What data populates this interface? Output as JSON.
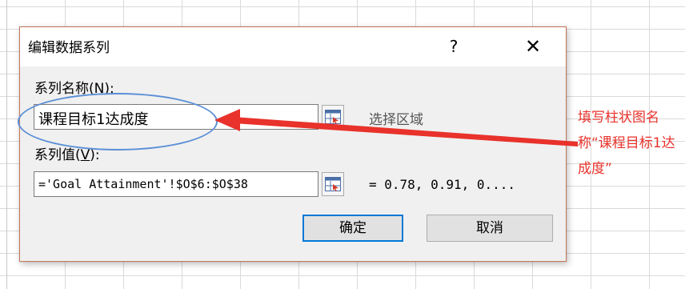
{
  "dialog": {
    "title": "编辑数据系列",
    "help_label": "?",
    "close_label": "✕",
    "series_name_label_prefix": "系列名称(",
    "series_name_label_key": "N",
    "series_name_label_suffix": "):",
    "series_name_value": "课程目标1达成度",
    "series_name_hint": "选择区域",
    "series_values_label_prefix": "系列值(",
    "series_values_label_key": "V",
    "series_values_label_suffix": "):",
    "series_values_value": "='Goal Attainment'!$O$6:$O$38",
    "series_values_preview": "= 0.78, 0.91, 0....",
    "ok_label": "确定",
    "cancel_label": "取消"
  },
  "annotation": {
    "text": "填写柱状图名称“课程目标1达成度”",
    "color": "#e8322b",
    "ellipse_color": "#5b8fd6"
  },
  "icons": {
    "range_button": "range-select-icon",
    "close": "close-icon",
    "help": "help-icon"
  }
}
